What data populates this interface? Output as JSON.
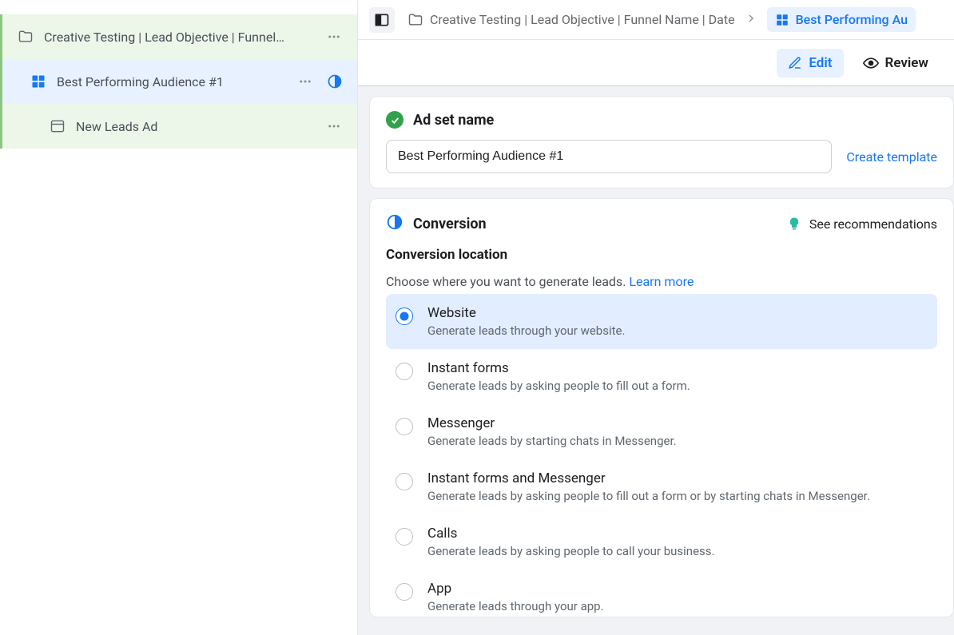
{
  "sidebar": {
    "items": [
      {
        "label": "Creative Testing | Lead Objective | Funnel…",
        "type": "campaign"
      },
      {
        "label": "Best Performing Audience #1",
        "type": "adset"
      },
      {
        "label": "New Leads Ad",
        "type": "ad"
      }
    ]
  },
  "breadcrumb": {
    "campaign": "Creative Testing | Lead Objective | Funnel Name | Date",
    "adset": "Best Performing Au"
  },
  "tabs": {
    "edit": "Edit",
    "review": "Review"
  },
  "adset_name": {
    "title": "Ad set name",
    "value": "Best Performing Audience #1",
    "create_template": "Create template"
  },
  "conversion": {
    "title": "Conversion",
    "recommendations": "See recommendations",
    "location_title": "Conversion location",
    "helper": "Choose where you want to generate leads. ",
    "learn_more": "Learn more",
    "options": [
      {
        "title": "Website",
        "desc": "Generate leads through your website.",
        "selected": true
      },
      {
        "title": "Instant forms",
        "desc": "Generate leads by asking people to fill out a form.",
        "selected": false
      },
      {
        "title": "Messenger",
        "desc": "Generate leads by starting chats in Messenger.",
        "selected": false
      },
      {
        "title": "Instant forms and Messenger",
        "desc": "Generate leads by asking people to fill out a form or by starting chats in Messenger.",
        "selected": false
      },
      {
        "title": "Calls",
        "desc": "Generate leads by asking people to call your business.",
        "selected": false
      },
      {
        "title": "App",
        "desc": "Generate leads through your app.",
        "selected": false
      }
    ]
  }
}
